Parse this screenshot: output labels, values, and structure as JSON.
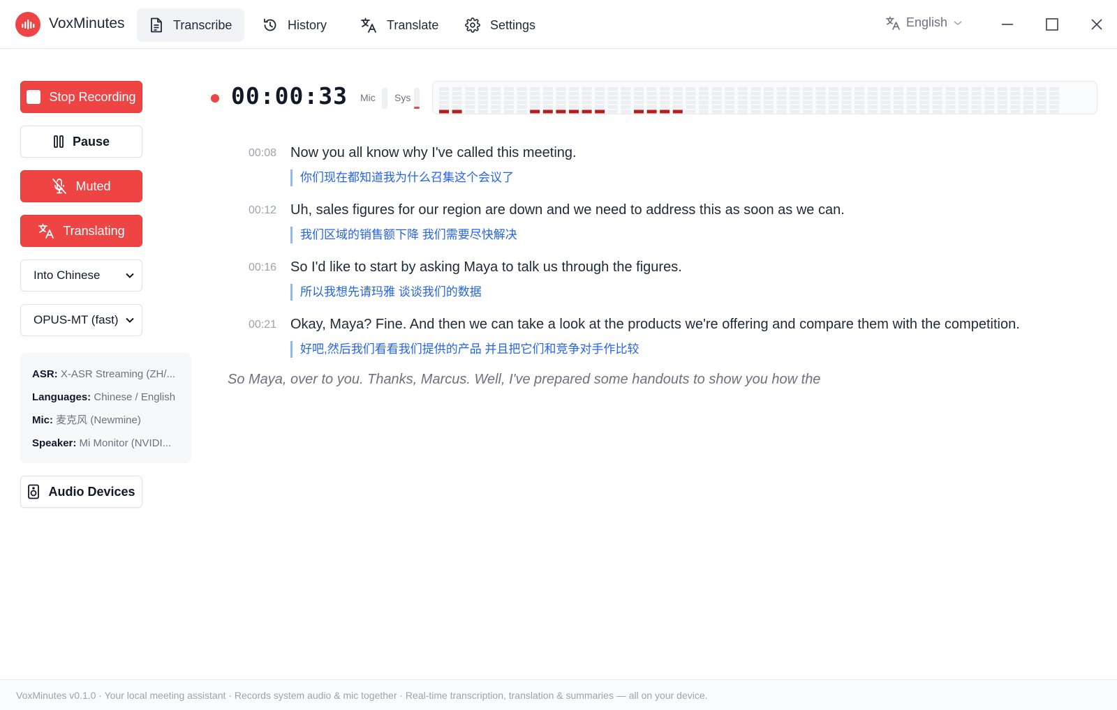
{
  "app": {
    "name": "VoxMinutes"
  },
  "nav": {
    "tabs": [
      {
        "label": "Transcribe",
        "icon": "document-icon",
        "active": true
      },
      {
        "label": "History",
        "icon": "history-icon",
        "active": false
      },
      {
        "label": "Translate",
        "icon": "translate-icon",
        "active": false
      },
      {
        "label": "Settings",
        "icon": "gear-icon",
        "active": false
      }
    ]
  },
  "language": {
    "selected": "English"
  },
  "sidebar": {
    "stop_label": "Stop Recording",
    "pause_label": "Pause",
    "muted_label": "Muted",
    "translating_label": "Translating",
    "target_language": "Into Chinese",
    "translation_model": "OPUS-MT (fast)",
    "info": {
      "asr_label": "ASR:",
      "asr_value": "X-ASR Streaming (ZH/...",
      "languages_label": "Languages:",
      "languages_value": "Chinese / English",
      "mic_label": "Mic:",
      "mic_value": "麦克风 (Newmine)",
      "speaker_label": "Speaker:",
      "speaker_value": "Mi Monitor (NVIDI..."
    },
    "audio_devices_label": "Audio Devices"
  },
  "recording": {
    "elapsed": "00:00:33",
    "mic_label": "Mic",
    "sys_label": "Sys",
    "mic_level": 0.0,
    "sys_level": 0.1,
    "active_color": "#ef4444",
    "level_color": "#b91c1c"
  },
  "transcript": {
    "segments": [
      {
        "time": "00:08",
        "text": "Now you all know why I've called this meeting.",
        "translation": "你们现在都知道我为什么召集这个会议了"
      },
      {
        "time": "00:12",
        "text": "Uh, sales figures for our region are down and we need to address this as soon as we can.",
        "translation": "我们区域的销售额下降 我们需要尽快解决"
      },
      {
        "time": "00:16",
        "text": "So I'd like to start by asking Maya to talk us through the figures.",
        "translation": "所以我想先请玛雅 谈谈我们的数据"
      },
      {
        "time": "00:21",
        "text": "Okay, Maya? Fine. And then we can take a look at the products we're offering and compare them with the competition.",
        "translation": "好吧,然后我们看看我们提供的产品 并且把它们和竞争对手作比较"
      }
    ],
    "partial": "So Maya, over to you. Thanks, Marcus. Well, I've prepared some handouts to show you how the"
  },
  "footer": {
    "text": "VoxMinutes v0.1.0 · Your local meeting assistant · Records system audio & mic together · Real-time transcription, translation & summaries — all on your device."
  },
  "colors": {
    "accent": "#ef4444",
    "translation": "#2563eb"
  }
}
